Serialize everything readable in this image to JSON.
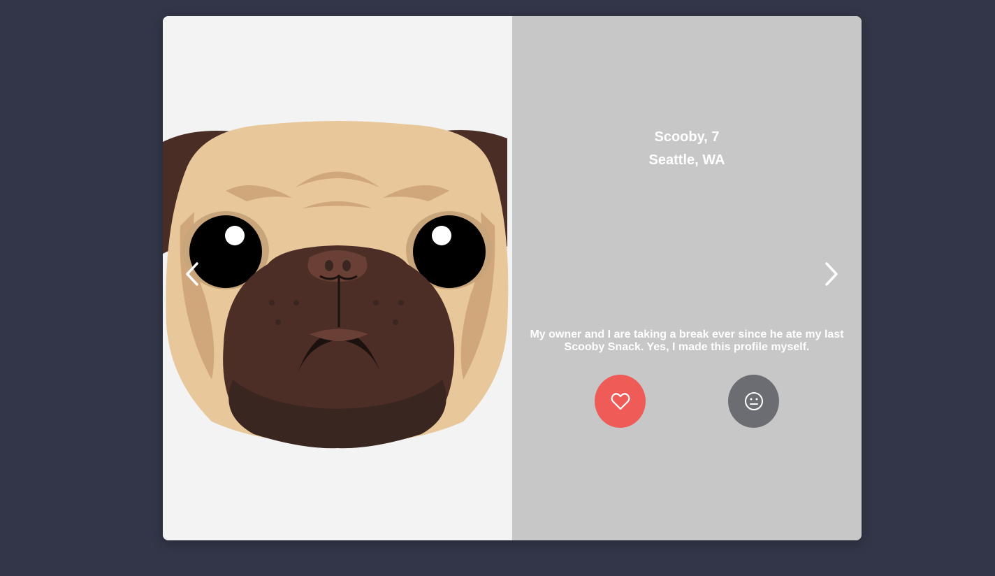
{
  "profile": {
    "name_age": "Scooby, 7",
    "location": "Seattle, WA",
    "bio": "My owner and I are taking a break ever since he ate my last Scooby Snack. Yes, I made this profile myself."
  },
  "photo": {
    "subject_icon": "pug-face-illustration"
  },
  "navigation": {
    "prev_icon": "chevron-left-icon",
    "next_icon": "chevron-right-icon"
  },
  "actions": {
    "like_icon": "heart-icon",
    "pass_icon": "neutral-face-icon"
  },
  "colors": {
    "background": "#323648",
    "info_panel": "#c7c7c7",
    "photo_panel": "#f3f3f3",
    "like": "#ef5b57",
    "pass": "#6c6d72",
    "text": "#ffffff"
  }
}
